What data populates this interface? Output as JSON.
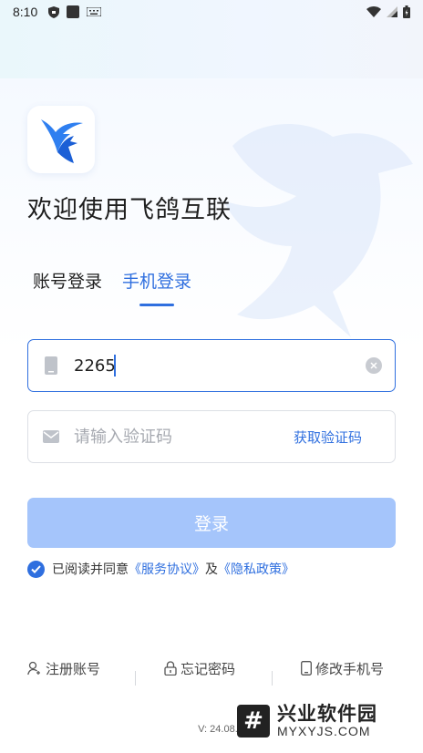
{
  "statusbar": {
    "time": "8:10"
  },
  "app": {
    "welcome": "欢迎使用飞鸽互联"
  },
  "tabs": [
    {
      "label": "账号登录",
      "active": false
    },
    {
      "label": "手机登录",
      "active": true
    }
  ],
  "phone_field": {
    "value": "2265"
  },
  "code_field": {
    "placeholder": "请输入验证码",
    "get_code_label": "获取验证码"
  },
  "login_button": {
    "label": "登录"
  },
  "agreement": {
    "prefix": "已阅读并同意",
    "service": "《服务协议》",
    "and": "及",
    "privacy": "《隐私政策》"
  },
  "bottom_links": [
    {
      "label": "注册账号",
      "icon": "user-add-icon"
    },
    {
      "label": "忘记密码",
      "icon": "lock-icon"
    },
    {
      "label": "修改手机号",
      "icon": "phone-icon"
    }
  ],
  "version": "V: 24.08.2",
  "watermark": {
    "title": "兴业软件园",
    "subtitle": "MYXYJS.COM"
  },
  "colors": {
    "accent": "#2f6fdf",
    "button_disabled": "#a5c5fb"
  }
}
